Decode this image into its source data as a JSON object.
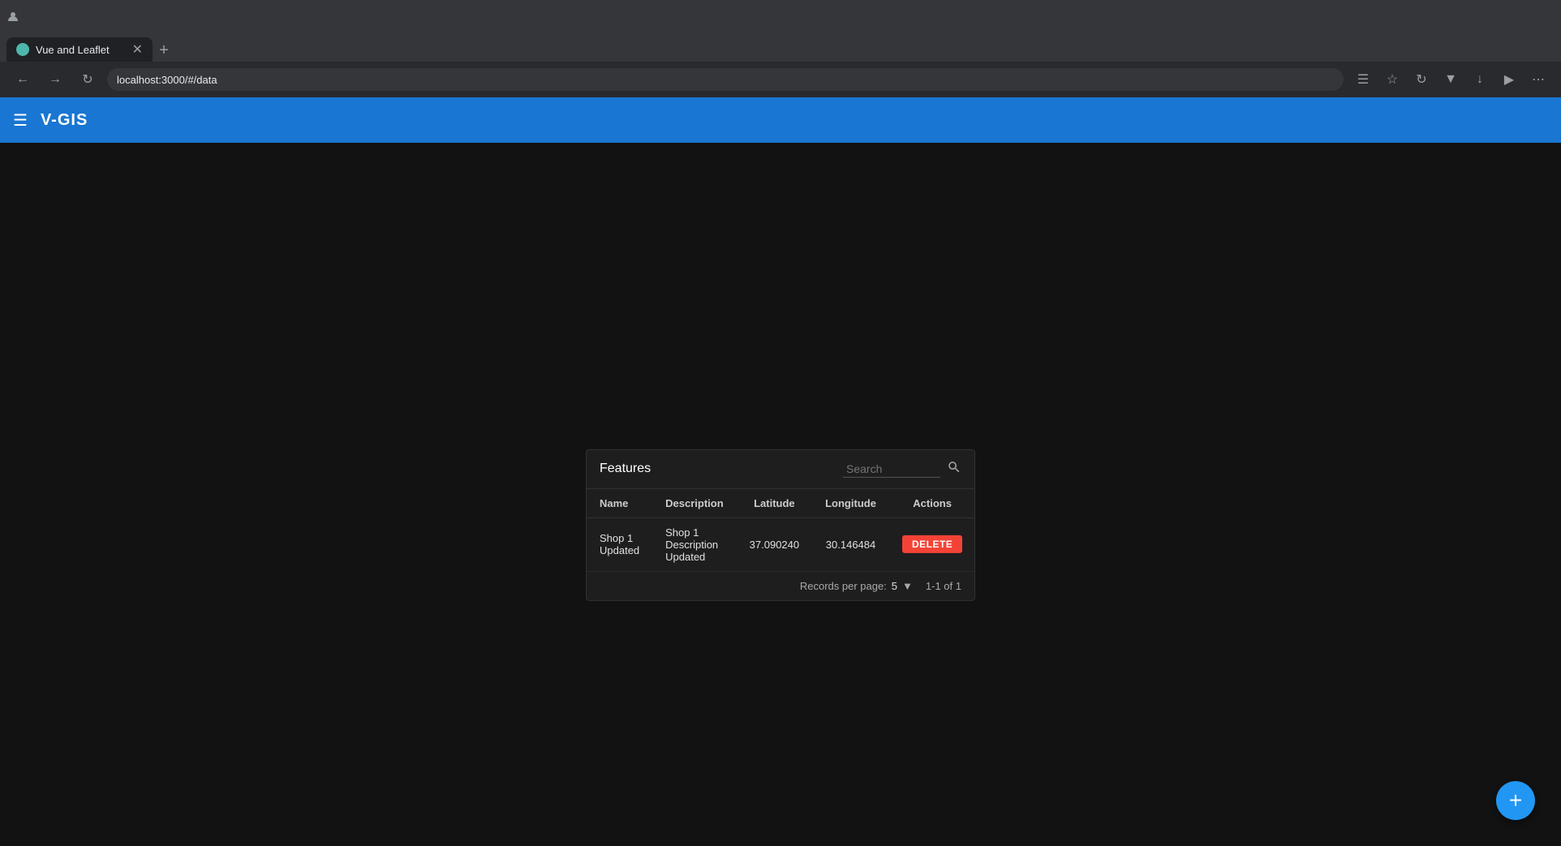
{
  "browser": {
    "tab_title": "Vue and Leaflet",
    "address": "localhost:3000/#/data",
    "new_tab_label": "+"
  },
  "app": {
    "title": "V-GIS",
    "menu_icon": "☰"
  },
  "features_card": {
    "title": "Features",
    "search_placeholder": "Search",
    "columns": {
      "name": "Name",
      "description": "Description",
      "latitude": "Latitude",
      "longitude": "Longitude",
      "actions": "Actions"
    },
    "rows": [
      {
        "name": "Shop 1 Updated",
        "description": "Shop 1 Description Updated",
        "latitude": "37.090240",
        "longitude": "30.146484",
        "action": "DELETE"
      }
    ],
    "footer": {
      "records_per_page_label": "Records per page:",
      "per_page_value": "5",
      "pagination": "1-1 of 1"
    }
  },
  "fab": {
    "label": "+"
  }
}
